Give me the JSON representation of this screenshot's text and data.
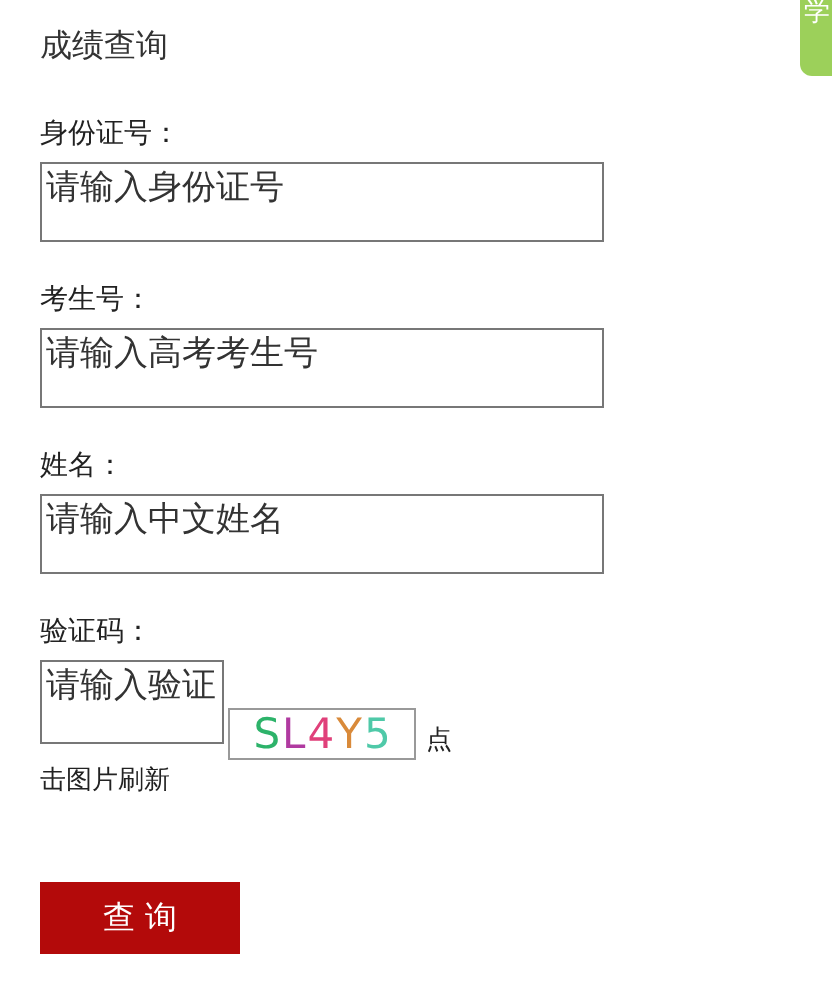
{
  "title": "成绩查询",
  "side_tab": {
    "label": "学"
  },
  "fields": [
    {
      "label": "身份证号：",
      "placeholder": "请输入身份证号"
    },
    {
      "label": "考生号：",
      "placeholder": "请输入高考考生号"
    },
    {
      "label": "姓名：",
      "placeholder": "请输入中文姓名"
    }
  ],
  "captcha": {
    "label": "验证码：",
    "placeholder": "请输入验证",
    "chars": [
      {
        "text": "S",
        "color": "#2db36a"
      },
      {
        "text": "L",
        "color": "#b03aa0"
      },
      {
        "text": "4",
        "color": "#e0407a"
      },
      {
        "text": "Y",
        "color": "#d98a3a"
      },
      {
        "text": "5",
        "color": "#4fc9a8"
      }
    ],
    "hint_start": "点",
    "hint_rest": "击图片刷新"
  },
  "submit": "查 询"
}
